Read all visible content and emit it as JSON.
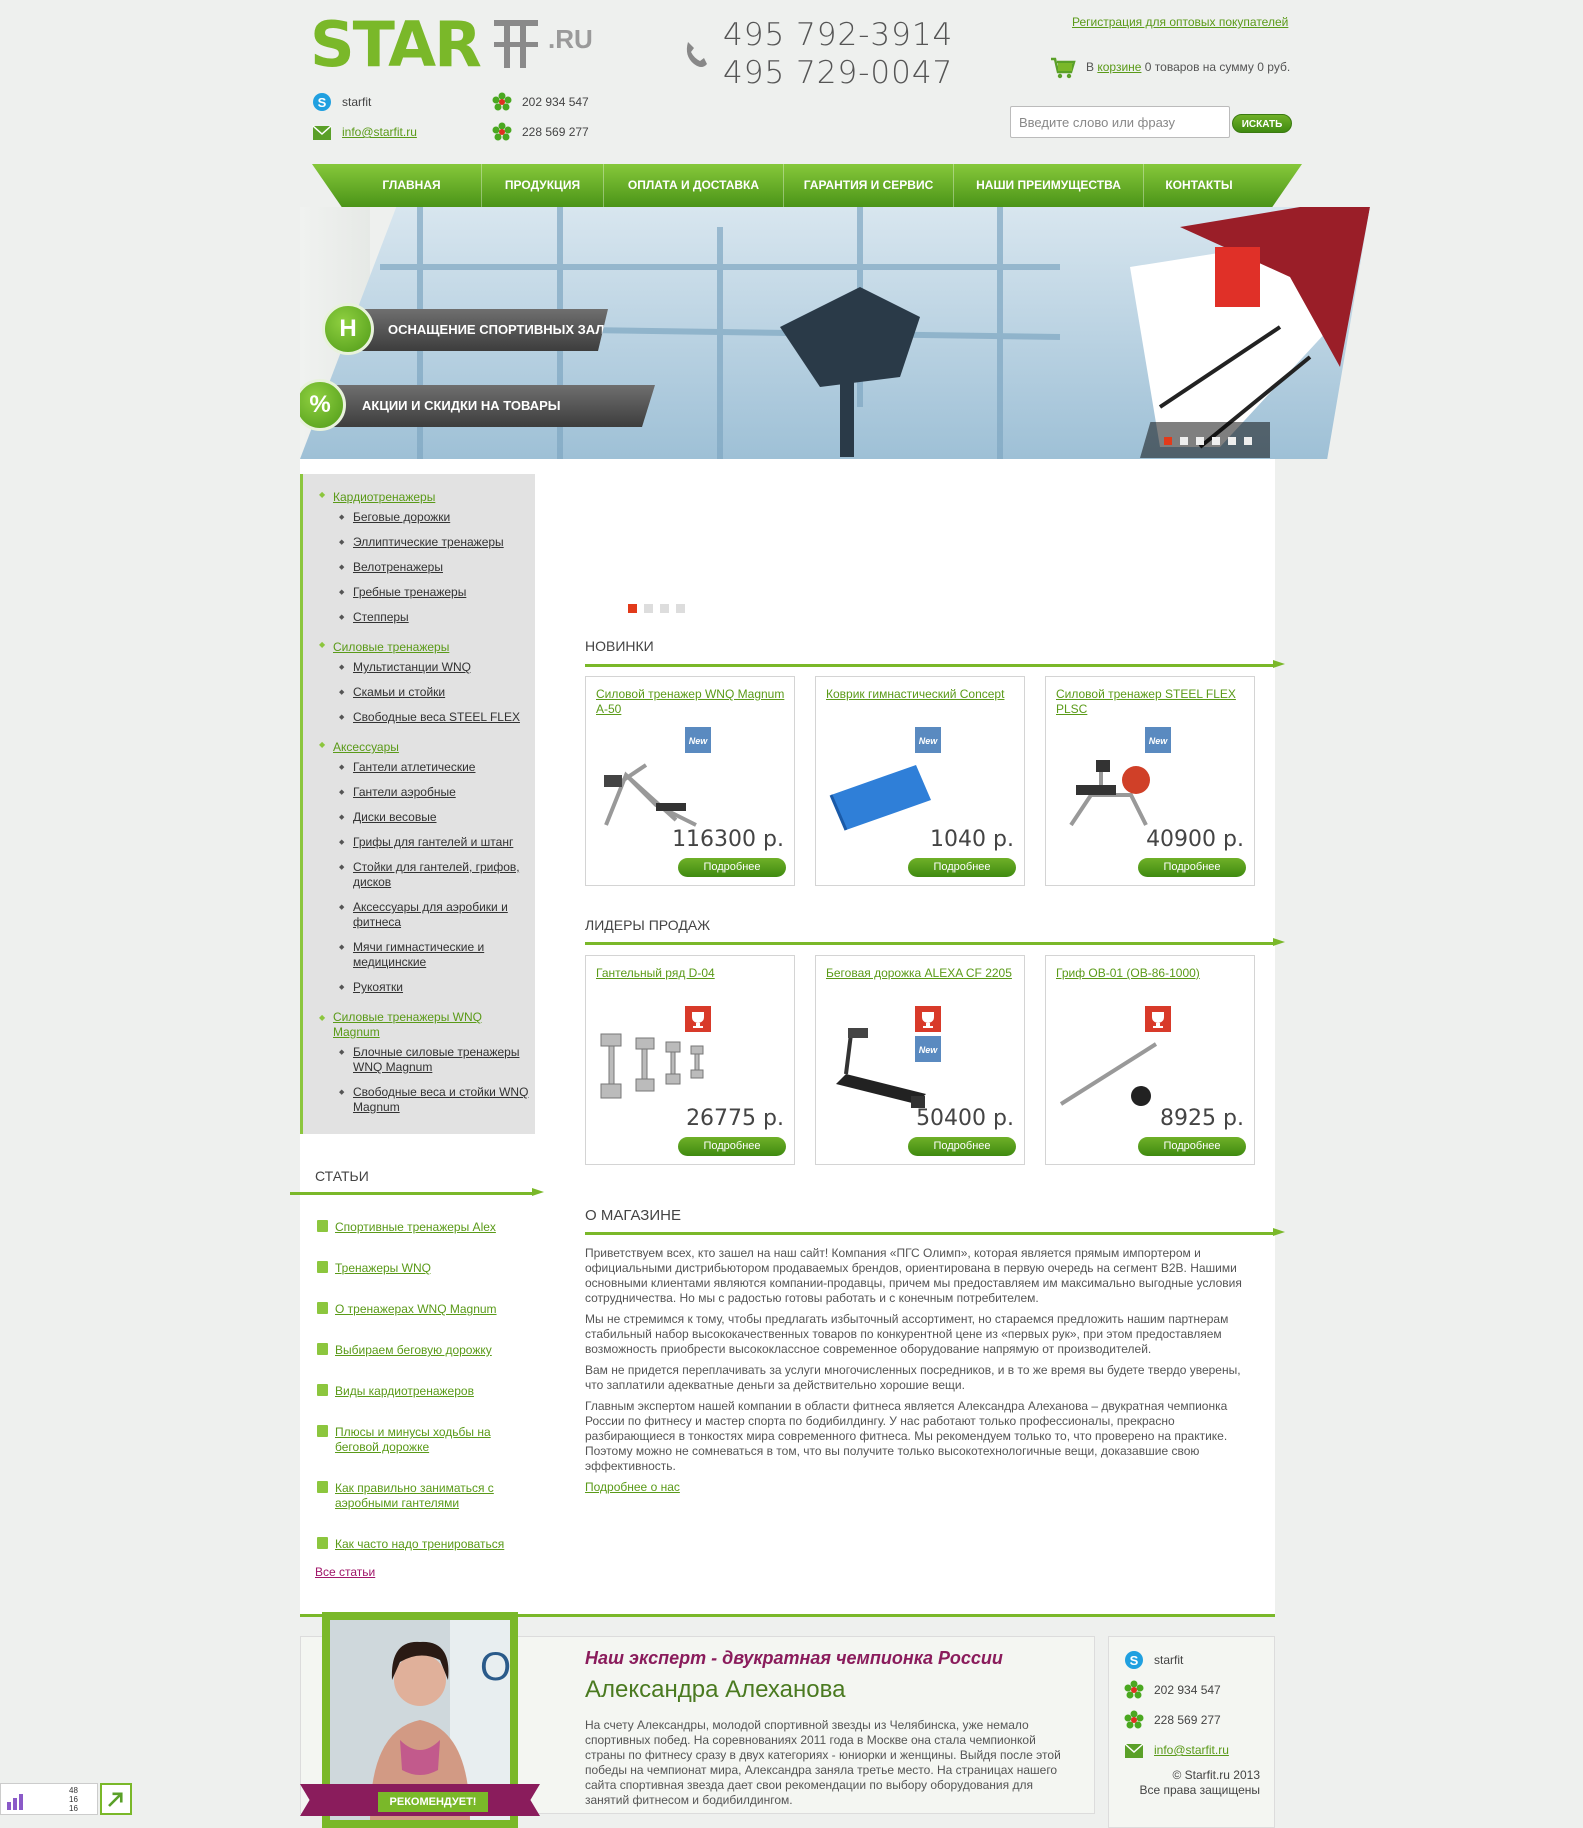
{
  "header": {
    "logo": {
      "main": "STAR",
      "suffix": ".RU"
    },
    "skype": "starfit",
    "email": "info@starfit.ru",
    "icq1": "202 934 547",
    "icq2": "228 569 277",
    "phone1": "495 792-3914",
    "phone2": "495 729-0047",
    "wholesale_link": "Регистрация для оптовых покупателей",
    "cart": {
      "prefix": "В ",
      "link": "корзине",
      "suffix": " 0 товаров на сумму 0 руб."
    },
    "search": {
      "placeholder": "Введите слово или фразу",
      "button": "ИСКАТЬ"
    }
  },
  "nav": [
    "ГЛАВНАЯ",
    "ПРОДУКЦИЯ",
    "ОПЛАТА И ДОСТАВКА",
    "ГАРАНТИЯ И СЕРВИС",
    "НАШИ ПРЕИМУЩЕСТВА",
    "КОНТАКТЫ"
  ],
  "banner": {
    "tag1": "ОСНАЩЕНИЕ СПОРТИВНЫХ ЗАЛОВ",
    "tag2": "АКЦИИ И СКИДКИ НА ТОВАРЫ",
    "icon2": "%"
  },
  "catalog": [
    {
      "name": "Кардиотренажеры",
      "items": [
        "Беговые дорожки",
        "Эллиптические тренажеры",
        "Велотренажеры",
        "Гребные тренажеры",
        "Степперы"
      ]
    },
    {
      "name": "Силовые тренажеры",
      "items": [
        "Мультистанции WNQ",
        "Скамьи и стойки",
        "Свободные веса STEEL FLEX"
      ]
    },
    {
      "name": "Аксессуары",
      "items": [
        "Гантели атлетические",
        "Гантели аэробные",
        "Диски весовые",
        "Грифы для гантелей и штанг",
        "Стойки для гантелей, грифов, дисков",
        "Аксессуары для аэробики и фитнеса",
        "Мячи гимнастические и медицинские",
        "Рукоятки"
      ]
    },
    {
      "name": "Силовые тренажеры WNQ Magnum",
      "items": [
        "Блочные силовые тренажеры WNQ Magnum",
        "Свободные веса и стойки WNQ Magnum"
      ]
    }
  ],
  "articles": {
    "title": "СТАТЬИ",
    "items": [
      "Спортивные тренажеры Alex",
      "Тренажеры WNQ",
      "О тренажерах WNQ Magnum",
      "Выбираем беговую дорожку",
      "Виды кардиотренажеров",
      "Плюсы и минусы ходьбы на беговой дорожке",
      "Как правильно заниматься с аэробными гантелями",
      "Как часто надо тренироваться"
    ],
    "all": "Все статьи"
  },
  "new": {
    "title": "НОВИНКИ",
    "items": [
      {
        "name": "Силовой тренажер WNQ Magnum A-50",
        "price": "116300 р.",
        "more": "Подробнее",
        "badge": "New"
      },
      {
        "name": "Коврик гимнастический Concept",
        "price": "1040 р.",
        "more": "Подробнее",
        "badge": "New"
      },
      {
        "name": "Силовой тренажер STEEL FLEX PLSC",
        "price": "40900 р.",
        "more": "Подробнее",
        "badge": "New"
      }
    ]
  },
  "leaders": {
    "title": "ЛИДЕРЫ ПРОДАЖ",
    "items": [
      {
        "name": "Гантельный ряд D-04",
        "price": "26775 р.",
        "more": "Подробнее"
      },
      {
        "name": "Беговая дорожка ALEXA CF 2205",
        "price": "50400 р.",
        "more": "Подробнее",
        "badge": "New"
      },
      {
        "name": "Гриф OB-01 (OB-86-1000)",
        "price": "8925 р.",
        "more": "Подробнее"
      }
    ]
  },
  "about": {
    "title": "О МАГАЗИНЕ",
    "paragraphs": [
      "Приветствуем всех, кто зашел на наш сайт! Компания «ПГС Олимп», которая является прямым импортером и официальными дистрибьютором продаваемых брендов, ориентирована в первую очередь на сегмент B2B. Нашими основными клиентами являются компании-продавцы, причем мы предоставляем им максимально выгодные условия сотрудничества. Но мы с радостью готовы работать и с конечным потребителем.",
      "Мы не стремимся к тому, чтобы предлагать избыточный ассортимент, но стараемся предложить нашим партнерам стабильный набор высококачественных товаров по конкурентной цене из «первых рук», при этом предоставляем возможность приобрести высококлассное современное оборудование напрямую от производителей.",
      "Вам не придется переплачивать за услуги многочисленных посредников, и в то же время вы будете твердо уверены, что заплатили адекватные деньги за действительно хорошие вещи.",
      "Главным экспертом нашей компании в области фитнеса является Александра Алеханова – двукратная чемпионка России по фитнесу и мастер спорта по бодибилдингу. У нас работают только профессионалы, прекрасно разбирающиеся в тонкостях мира современного фитнеса. Мы рекомендуем только то, что проверено на практике. Поэтому можно не сомневаться в том, что вы получите только высокотехнологичные вещи, доказавшие свою эффективность."
    ],
    "more": "Подробнее о нас"
  },
  "expert": {
    "title": "Наш эксперт - двукратная чемпионка России",
    "name": "Александра Алеханова",
    "recommends": "РЕКОМЕНДУЕТ!",
    "text": "На счету Александры, молодой спортивной звезды из Челябинска, уже немало спортивных побед. На соревнованиях 2011 года в Москве она стала чемпионкой страны по фитнесу сразу в двух категориях - юниорки и женщины. Выйдя после этой победы на чемпионат мира, Александра заняла третье место. На страницах нашего сайта спортивная звезда дает свои рекомендации по выбору оборудования для занятий фитнесом и бодибилдингом."
  },
  "footer": {
    "copyright": "© Starfit.ru 2013",
    "rights": "Все права защищены"
  },
  "widget": {
    "l1": "48",
    "l2": "16",
    "l3": "16"
  },
  "colors": {
    "accent": "#7ab829",
    "brand_dark": "#4b9418",
    "expert_title": "#8a1c5c"
  }
}
